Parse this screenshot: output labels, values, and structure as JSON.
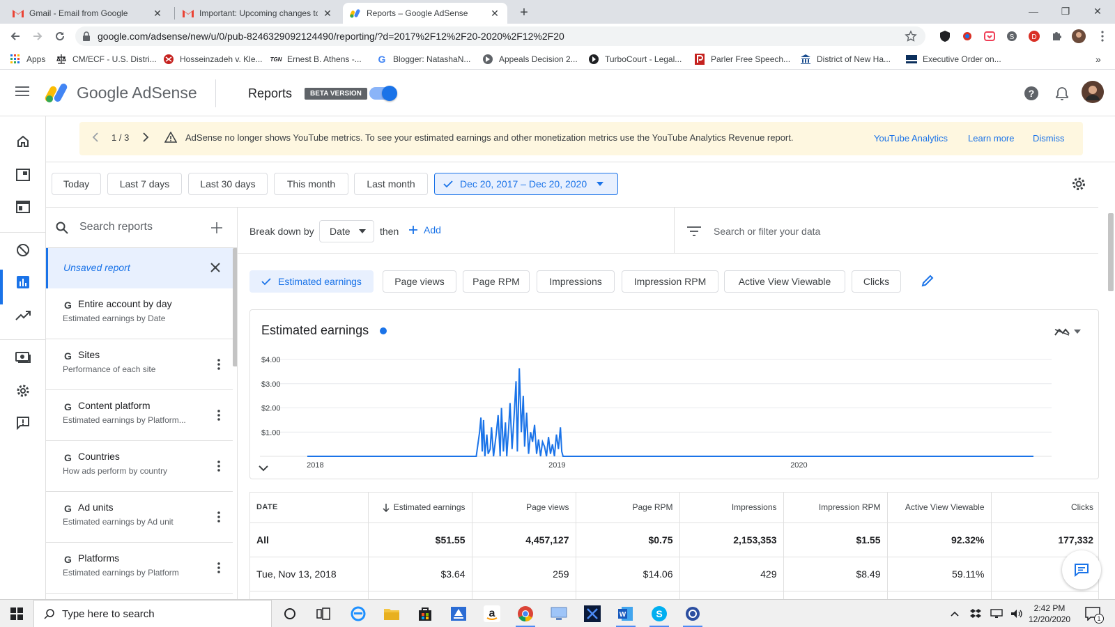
{
  "browser": {
    "tabs": [
      {
        "title": "Gmail - Email from Google",
        "icon": "gmail-icon"
      },
      {
        "title": "Important: Upcoming changes to",
        "icon": "gmail-icon"
      },
      {
        "title": "Reports – Google AdSense",
        "icon": "adsense-icon"
      }
    ],
    "new_tab": "+",
    "url": "google.com/adsense/new/u/0/pub-8246329092124490/reporting/?d=2017%2F12%2F20-2020%2F12%2F20",
    "bookmarks": [
      {
        "label": "Apps",
        "icon": "apps-grid-icon"
      },
      {
        "label": "CM/ECF - U.S. Distri...",
        "icon": "scales-icon"
      },
      {
        "label": "Hosseinzadeh v. Kle...",
        "icon": "red-globe-icon"
      },
      {
        "label": "Ernest B. Athens -...",
        "icon": "tgn-icon"
      },
      {
        "label": "Blogger: NatashaN...",
        "icon": "google-g-icon"
      },
      {
        "label": "Appeals Decision 2...",
        "icon": "globe-icon"
      },
      {
        "label": "TurboCourt - Legal...",
        "icon": "turbocourt-icon"
      },
      {
        "label": "Parler Free Speech...",
        "icon": "parler-icon"
      },
      {
        "label": "District of New Ha...",
        "icon": "courthouse-icon"
      },
      {
        "label": "Executive Order on...",
        "icon": "flag-icon"
      }
    ],
    "more_bookmarks": "»"
  },
  "header": {
    "product": "Google AdSense",
    "page": "Reports",
    "beta_label": "BETA VERSION",
    "beta_toggle_on": true
  },
  "banner": {
    "pager": "1 / 3",
    "message": "AdSense no longer shows YouTube metrics. To see your estimated earnings and other monetization metrics use the YouTube Analytics Revenue report.",
    "links": [
      "YouTube Analytics",
      "Learn more",
      "Dismiss"
    ]
  },
  "date_presets": [
    "Today",
    "Last 7 days",
    "Last 30 days",
    "This month",
    "Last month"
  ],
  "date_range": "Dec 20, 2017 – Dec 20, 2020",
  "sidebar": {
    "search_placeholder": "Search reports",
    "unsaved": "Unsaved report",
    "reports": [
      {
        "title": "Entire account by day",
        "subtitle": "Estimated earnings by Date"
      },
      {
        "title": "Sites",
        "subtitle": "Performance of each site"
      },
      {
        "title": "Content platform",
        "subtitle": "Estimated earnings by Platform..."
      },
      {
        "title": "Countries",
        "subtitle": "How ads perform by country"
      },
      {
        "title": "Ad units",
        "subtitle": "Estimated earnings by Ad unit"
      },
      {
        "title": "Platforms",
        "subtitle": "Estimated earnings by Platform"
      }
    ],
    "google_letter": "G"
  },
  "breakdown": {
    "label": "Break down by",
    "selected": "Date",
    "then": "then",
    "add": "Add",
    "filter_placeholder": "Search or filter your data"
  },
  "metrics": {
    "selected": "Estimated earnings",
    "others": [
      "Page views",
      "Page RPM",
      "Impressions",
      "Impression RPM",
      "Active View Viewable",
      "Clicks"
    ]
  },
  "chart": {
    "title": "Estimated earnings",
    "y_ticks": [
      "$4.00",
      "$3.00",
      "$2.00",
      "$1.00"
    ],
    "x_ticks": [
      "2018",
      "2019",
      "2020"
    ]
  },
  "chart_data": {
    "type": "line",
    "title": "Estimated earnings",
    "xlabel": "",
    "ylabel": "",
    "ylim": [
      0,
      4
    ],
    "x_ticks": [
      "2018",
      "2019",
      "2020"
    ],
    "y_ticks": [
      1,
      2,
      3,
      4
    ],
    "series": [
      {
        "name": "Estimated earnings",
        "color": "#1a73e8",
        "x": [
          "2017-12-20",
          "2018-09-01",
          "2018-09-06",
          "2018-09-08",
          "2018-09-10",
          "2018-09-12",
          "2018-09-14",
          "2018-09-17",
          "2018-09-19",
          "2018-09-22",
          "2018-09-24",
          "2018-09-27",
          "2018-10-01",
          "2018-10-04",
          "2018-10-07",
          "2018-10-09",
          "2018-10-12",
          "2018-10-15",
          "2018-10-17",
          "2018-10-20",
          "2018-10-22",
          "2018-10-25",
          "2018-10-28",
          "2018-10-31",
          "2018-11-02",
          "2018-11-05",
          "2018-11-08",
          "2018-11-11",
          "2018-11-13",
          "2018-11-16",
          "2018-11-19",
          "2018-11-22",
          "2018-11-25",
          "2018-11-28",
          "2018-12-01",
          "2018-12-04",
          "2018-12-07",
          "2018-12-10",
          "2018-12-13",
          "2018-12-16",
          "2018-12-19",
          "2018-12-22",
          "2018-12-25",
          "2018-12-28",
          "2018-12-31",
          "2019-01-03",
          "2019-01-06",
          "2019-01-08",
          "2019-01-10",
          "2019-01-15",
          "2020-12-20"
        ],
        "y": [
          0,
          0,
          1.0,
          1.6,
          0.2,
          1.5,
          0,
          0.9,
          0.1,
          0.3,
          1.2,
          0,
          0.9,
          1.7,
          0,
          2.0,
          0.2,
          1.4,
          0,
          1.2,
          2.2,
          0.3,
          1.6,
          3.1,
          0.2,
          3.64,
          1.0,
          2.5,
          0.4,
          1.8,
          0.1,
          1.0,
          0.6,
          1.3,
          0.1,
          0.7,
          0,
          0.6,
          0.4,
          0,
          0.8,
          0.1,
          0.5,
          0,
          0.9,
          0.3,
          1.2,
          0.2,
          0,
          0,
          0
        ]
      }
    ]
  },
  "table": {
    "columns": [
      "DATE",
      "Estimated earnings",
      "Page views",
      "Page RPM",
      "Impressions",
      "Impression RPM",
      "Active View Viewable",
      "Clicks"
    ],
    "total": [
      "All",
      "$51.55",
      "4,457,127",
      "$0.75",
      "2,153,353",
      "$1.55",
      "92.32%",
      "177,332"
    ],
    "rows": [
      [
        "Tue, Nov 13, 2018",
        "$3.64",
        "259",
        "$14.06",
        "429",
        "$8.49",
        "59.11%",
        ""
      ]
    ]
  },
  "taskbar": {
    "search_placeholder": "Type here to search",
    "time": "2:42 PM",
    "date": "12/20/2020",
    "notifications": "1"
  }
}
